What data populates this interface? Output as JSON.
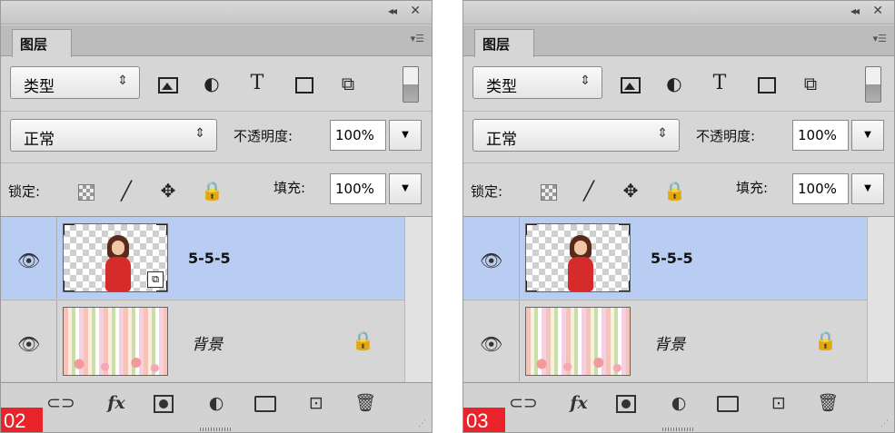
{
  "panels": [
    {
      "step": "02",
      "window": {
        "collapse_glyph": "◂◂",
        "close_glyph": "✕"
      },
      "tab_label": "图层",
      "panel_menu_glyph": "▾☰",
      "kind_filter": {
        "value": "类型",
        "arrow": "⇕"
      },
      "filter_icons": [
        "image-filter-icon",
        "adjustment-filter-icon",
        "type-filter-icon",
        "shape-filter-icon",
        "smart-object-filter-icon"
      ],
      "type_glyph": "T",
      "blend_mode": {
        "value": "正常",
        "arrow": "⇕"
      },
      "opacity": {
        "label": "不透明度:",
        "value": "100%"
      },
      "lock": {
        "label": "锁定:",
        "move_glyph": "✥",
        "lock_glyph": "🔒",
        "paint_glyph": "╱"
      },
      "fill": {
        "label": "填充:",
        "value": "100%"
      },
      "dropdown_arrow": "▼",
      "layers": [
        {
          "name": "5-5-5",
          "selected": true,
          "thumbnail": "woman-transparent",
          "smart_badge": "⧉",
          "visibility": "👁"
        },
        {
          "name": "背景",
          "selected": false,
          "thumbnail": "stripes-flowers",
          "locked": true,
          "visibility": "👁",
          "lock_glyph": "🔒"
        }
      ],
      "footer_icons": {
        "link": "⊂⊃",
        "fx": "fx",
        "adj": "◐",
        "new": "⊡",
        "delete": "🗑"
      }
    },
    {
      "step": "03",
      "window": {
        "collapse_glyph": "◂◂",
        "close_glyph": "✕"
      },
      "tab_label": "图层",
      "panel_menu_glyph": "▾☰",
      "kind_filter": {
        "value": "类型",
        "arrow": "⇕"
      },
      "filter_icons": [
        "image-filter-icon",
        "adjustment-filter-icon",
        "type-filter-icon",
        "shape-filter-icon",
        "smart-object-filter-icon"
      ],
      "type_glyph": "T",
      "blend_mode": {
        "value": "正常",
        "arrow": "⇕"
      },
      "opacity": {
        "label": "不透明度:",
        "value": "100%"
      },
      "lock": {
        "label": "锁定:",
        "move_glyph": "✥",
        "lock_glyph": "🔒",
        "paint_glyph": "╱"
      },
      "fill": {
        "label": "填充:",
        "value": "100%"
      },
      "dropdown_arrow": "▼",
      "layers": [
        {
          "name": "5-5-5",
          "selected": true,
          "thumbnail": "woman-transparent",
          "visibility": "👁"
        },
        {
          "name": "背景",
          "selected": false,
          "thumbnail": "stripes-flowers",
          "locked": true,
          "visibility": "👁",
          "lock_glyph": "🔒"
        }
      ],
      "footer_icons": {
        "link": "⊂⊃",
        "fx": "fx",
        "adj": "◐",
        "new": "⊡",
        "delete": "🗑"
      }
    }
  ],
  "colors": {
    "selected_layer": "#b9cdf3",
    "badge": "#e8232a",
    "panel_bg": "#d6d6d6"
  }
}
